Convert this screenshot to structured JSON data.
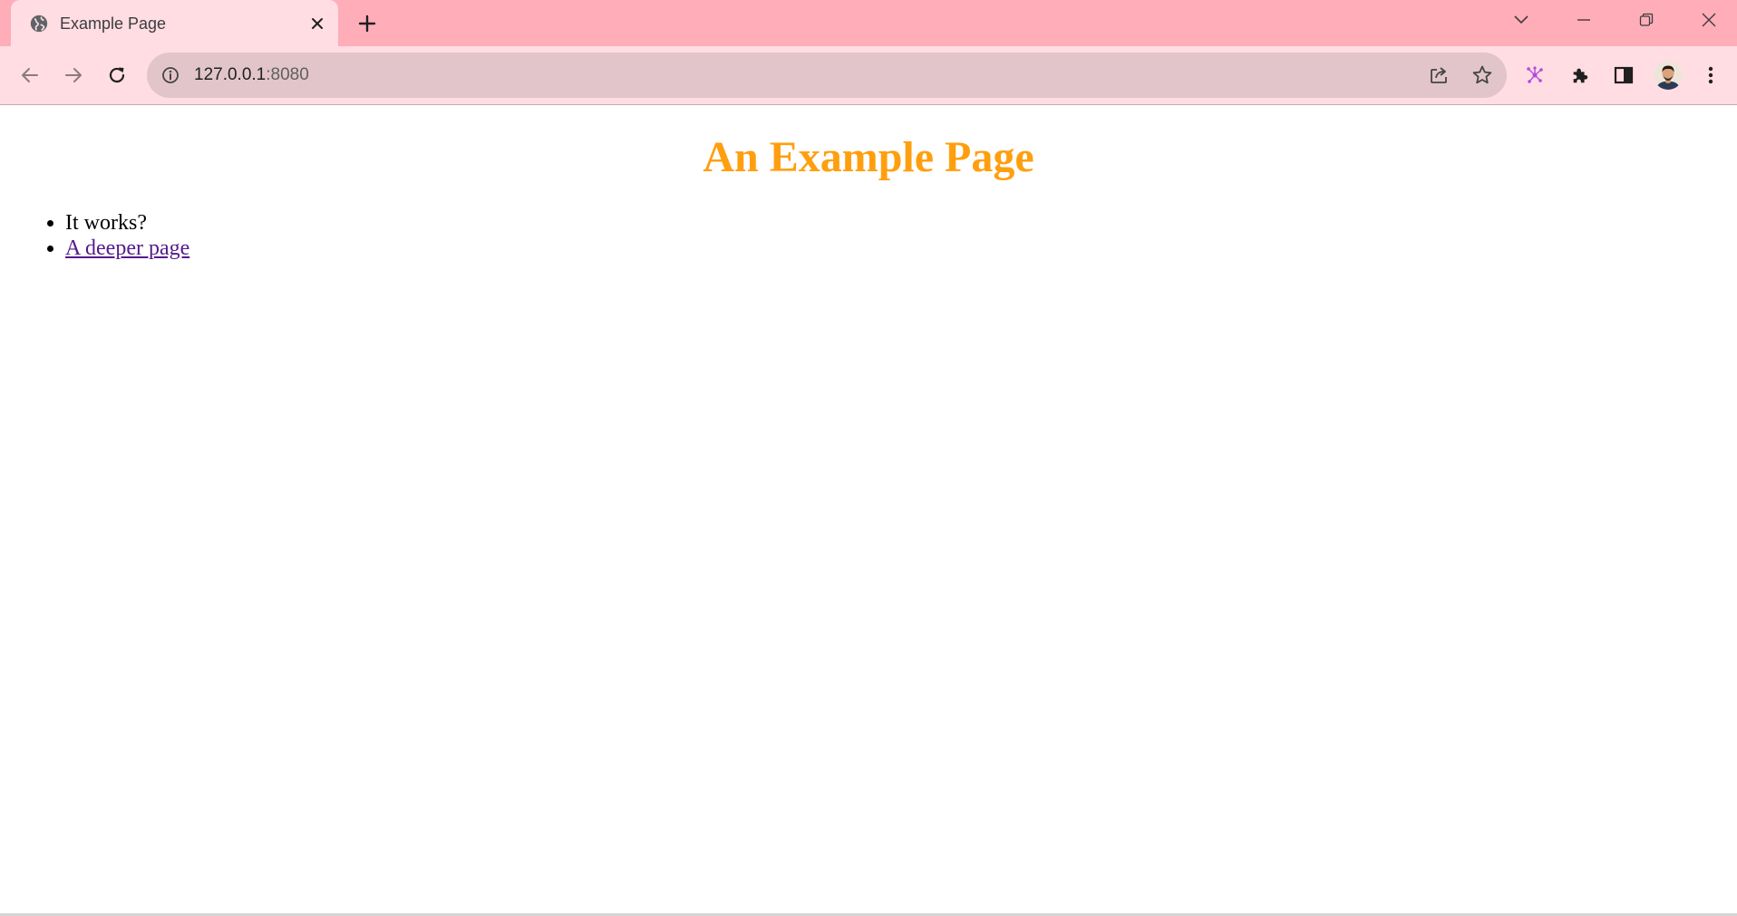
{
  "browser": {
    "tab": {
      "title": "Example Page",
      "favicon": "globe-icon"
    },
    "address_bar": {
      "host": "127.0.0.1",
      "port": ":8080",
      "info_icon": "info-icon"
    },
    "icons": {
      "back": "arrow-left-icon",
      "forward": "arrow-right-icon",
      "reload": "reload-icon",
      "share": "share-icon",
      "bookmark": "star-icon",
      "extension_custom": "network-nodes-icon",
      "extensions": "puzzle-icon",
      "side_panel": "side-panel-icon",
      "menu": "kebab-menu-icon",
      "tab_search": "chevron-down-icon",
      "minimize": "minimize-icon",
      "restore": "restore-icon",
      "close": "close-icon"
    },
    "colors": {
      "tabstrip": "#ffadb9",
      "toolbar": "#ffdde3",
      "omnibox": "#e2c5ca"
    }
  },
  "page": {
    "title": "An Example Page",
    "items": [
      {
        "text": "It works?"
      },
      {
        "text": "A deeper page",
        "is_link": true
      }
    ],
    "colors": {
      "title": "#ff9f0f",
      "link_visited": "#551a8b"
    }
  }
}
